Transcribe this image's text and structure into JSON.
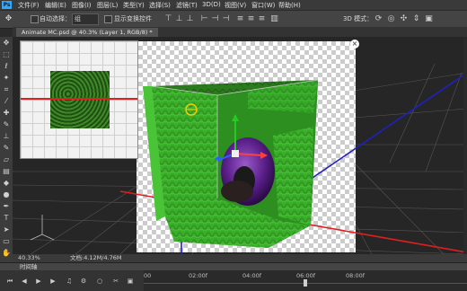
{
  "menubar": {
    "logo": "Ps",
    "items": [
      "文件(F)",
      "编辑(E)",
      "图像(I)",
      "图层(L)",
      "类型(Y)",
      "选择(S)",
      "滤镜(T)",
      "3D(D)",
      "视图(V)",
      "窗口(W)",
      "帮助(H)"
    ]
  },
  "options": {
    "auto_select_label": "自动选择：",
    "auto_select_value": "组",
    "show_transform_label": "显示变换控件",
    "mode_label": "3D 模式："
  },
  "document": {
    "tab_title": "Animate MC.psd @ 40.3% (Layer 1, RGB/8) *"
  },
  "status": {
    "zoom": "40.33%",
    "doc_info": "文档:4.12M/4.76M"
  },
  "timeline": {
    "label": "时间轴",
    "ticks": [
      "00",
      "02:00f",
      "04:00f",
      "06:00f",
      "08:00f"
    ]
  },
  "colors": {
    "accent": "#31a8ff",
    "cube_green": "#35b52a",
    "torus_purple": "#5a1f8a",
    "axis_red": "#e02020",
    "axis_blue": "#2020c0"
  },
  "icons": {
    "move": "move-icon",
    "close": "close-icon",
    "play": "play-icon",
    "scissors": "scissors-icon"
  }
}
